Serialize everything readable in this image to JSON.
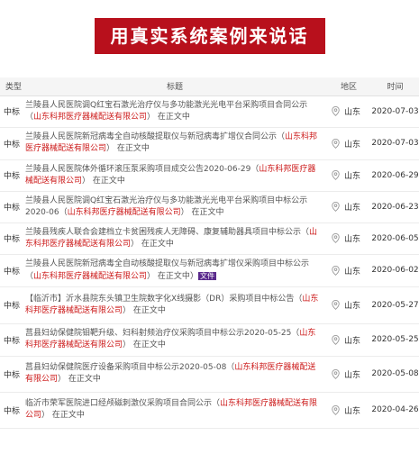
{
  "banner": {
    "title": "用真实系统案例来说话"
  },
  "table": {
    "headers": {
      "type": "类型",
      "title": "标题",
      "region": "地区",
      "time": "时间"
    },
    "rows": [
      {
        "type": "中标",
        "title": "兰陵县人民医院调Q红宝石激光治疗仪与多功能激光光电平台采购项目合同公示（",
        "company": "山东科邦医疗器械配送有限公司",
        "status": "在正文中",
        "file": "",
        "region": "山东",
        "date": "2020-07-03"
      },
      {
        "type": "中标",
        "title": "兰陵县人民医院新冠病毒全自动核酸提取仪与新冠病毒扩增仪合同公示（",
        "company": "山东科邦医疗器械配送有限公司",
        "status": "在正文中",
        "file": "",
        "region": "山东",
        "date": "2020-07-03"
      },
      {
        "type": "中标",
        "title": "兰陵县人民医院体外循环滚压泵采购项目成交公告2020-06-29（",
        "company": "山东科邦医疗器械配送有限公司",
        "status": "在正文中",
        "file": "",
        "region": "山东",
        "date": "2020-06-29"
      },
      {
        "type": "中标",
        "title": "兰陵县人民医院调Q红宝石激光治疗仪与多功能激光光电平台采购项目中标公示2020-06（",
        "company": "山东科邦医疗器械配送有限公司",
        "status": "在正文中",
        "file": "",
        "region": "山东",
        "date": "2020-06-23"
      },
      {
        "type": "中标",
        "title": "兰陵县残疾人联合会建档立卡贫困残疾人无障碍、康复辅助器具项目中标公示（",
        "company": "山东科邦医疗器械配送有限公司",
        "status": "在正文中",
        "file": "",
        "region": "山东",
        "date": "2020-06-05"
      },
      {
        "type": "中标",
        "title": "兰陵县人民医院新冠病毒全自动核酸提取仪与新冠病毒扩增仪采购项目中标公示（",
        "company": "山东科邦医疗器械配送有限公司",
        "status": "在正文中",
        "file": "文件",
        "region": "山东",
        "date": "2020-06-02"
      },
      {
        "type": "中标",
        "title": "【临沂市】沂水县院东头镇卫生院数字化X线摄影（DR）采购项目中标公告（",
        "company": "山东科邦医疗器械配送有限公司",
        "status": "在正文中",
        "file": "",
        "region": "山东",
        "date": "2020-05-27"
      },
      {
        "type": "中标",
        "title": "莒县妇幼保健院钼靶升级、妇科射频治疗仪采购项目中标公示2020-05-25（",
        "company": "山东科邦医疗器械配送有限公司",
        "status": "在正文中",
        "file": "",
        "region": "山东",
        "date": "2020-05-25"
      },
      {
        "type": "中标",
        "title": "莒县妇幼保健院医疗设备采购项目中标公示2020-05-08（",
        "company": "山东科邦医疗器械配送有限公司",
        "status": "在正文中",
        "file": "",
        "region": "山东",
        "date": "2020-05-08"
      },
      {
        "type": "中标",
        "title": "临沂市荣军医院进口经颅磁刺激仪采购项目合同公示（",
        "company": "山东科邦医疗器械配送有限公司",
        "status": "在正文中",
        "file": "",
        "region": "山东",
        "date": "2020-04-26"
      }
    ]
  },
  "colors": {
    "banner_bg": "#b8101c",
    "company_text": "#cc1a1a",
    "file_badge": "#5a2a8c"
  },
  "icons": {
    "region": "location-pin-icon"
  }
}
